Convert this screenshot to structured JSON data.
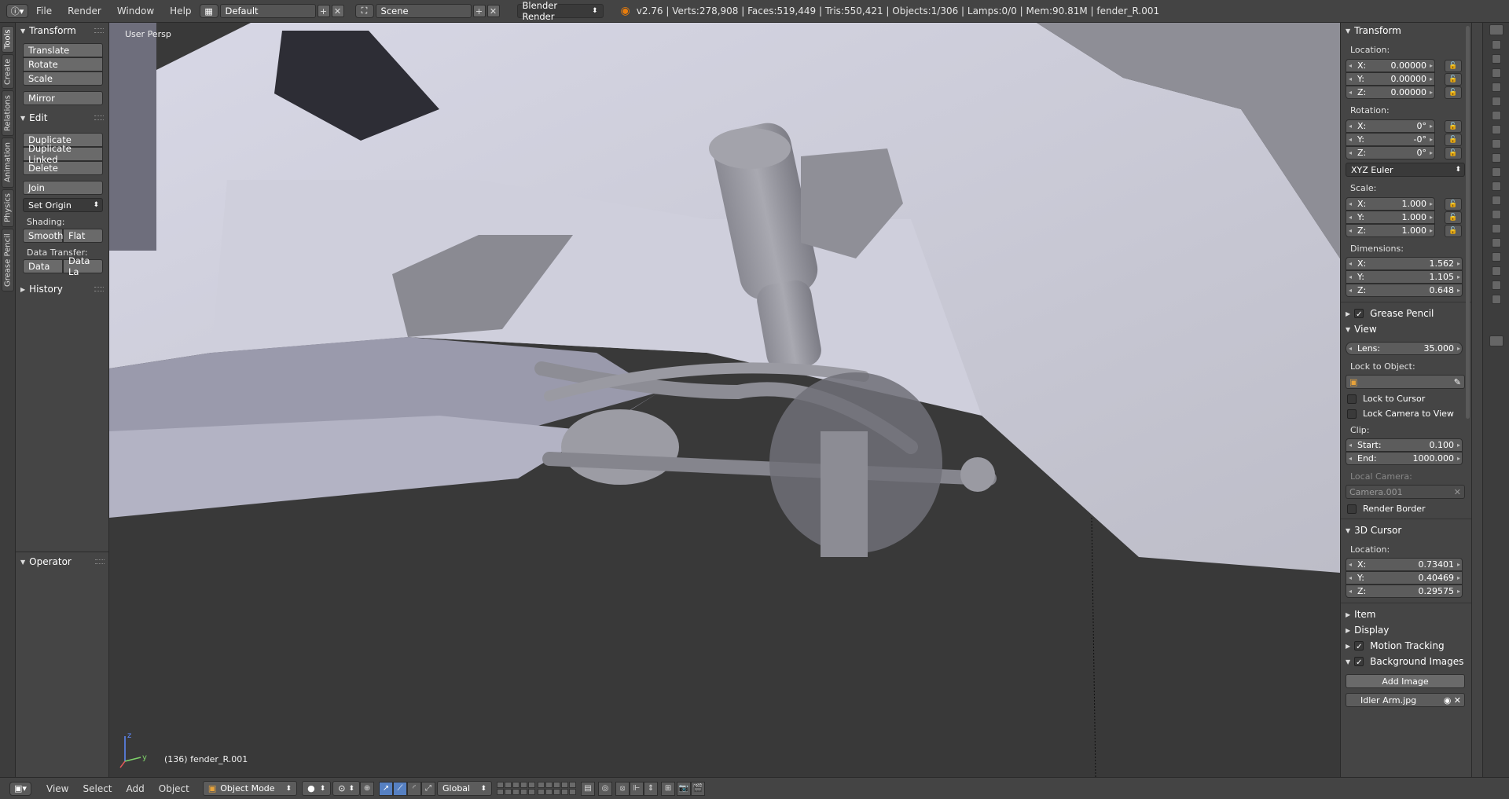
{
  "topbar": {
    "menus": [
      "File",
      "Render",
      "Window",
      "Help"
    ],
    "screen_layout": "Default",
    "scene": "Scene",
    "render_engine": "Blender Render",
    "stats": "v2.76 | Verts:278,908 | Faces:519,449 | Tris:550,421 | Objects:1/306 | Lamps:0/0 | Mem:90.81M | fender_R.001"
  },
  "tabs": [
    "Tools",
    "Create",
    "Relations",
    "Animation",
    "Physics",
    "Grease Pencil"
  ],
  "toolshelf": {
    "transform_title": "Transform",
    "translate": "Translate",
    "rotate": "Rotate",
    "scale": "Scale",
    "mirror": "Mirror",
    "edit_title": "Edit",
    "duplicate": "Duplicate",
    "duplicate_linked": "Duplicate Linked",
    "delete": "Delete",
    "join": "Join",
    "set_origin": "Set Origin",
    "shading_label": "Shading:",
    "smooth": "Smooth",
    "flat": "Flat",
    "data_transfer_label": "Data Transfer:",
    "data": "Data",
    "data_la": "Data La",
    "history_title": "History",
    "operator_title": "Operator"
  },
  "viewport": {
    "view_label": "User Persp",
    "object_label": "(136) fender_R.001",
    "axis_z": "z",
    "axis_y": "y"
  },
  "npanel": {
    "transform_title": "Transform",
    "location_label": "Location:",
    "location": {
      "x": "0.00000",
      "y": "0.00000",
      "z": "0.00000"
    },
    "rotation_label": "Rotation:",
    "rotation": {
      "x": "0°",
      "y": "-0°",
      "z": "0°"
    },
    "rotation_mode": "XYZ Euler",
    "scale_label": "Scale:",
    "scale": {
      "x": "1.000",
      "y": "1.000",
      "z": "1.000"
    },
    "dimensions_label": "Dimensions:",
    "dimensions": {
      "x": "1.562",
      "y": "1.105",
      "z": "0.648"
    },
    "grease_pencil_title": "Grease Pencil",
    "view_title": "View",
    "lens_label": "Lens:",
    "lens": "35.000",
    "lock_to_object_label": "Lock to Object:",
    "lock_to_cursor": "Lock to Cursor",
    "lock_camera_to_view": "Lock Camera to View",
    "clip_label": "Clip:",
    "clip_start_label": "Start:",
    "clip_start": "0.100",
    "clip_end_label": "End:",
    "clip_end": "1000.000",
    "local_camera_label": "Local Camera:",
    "local_camera": "Camera.001",
    "render_border": "Render Border",
    "cursor_title": "3D Cursor",
    "cursor_location_label": "Location:",
    "cursor": {
      "x": "0.73401",
      "y": "0.40469",
      "z": "0.29575"
    },
    "item_title": "Item",
    "display_title": "Display",
    "motion_tracking_title": "Motion Tracking",
    "background_images_title": "Background Images",
    "add_image": "Add Image",
    "bg_image_name": "Idler Arm.jpg"
  },
  "bottombar": {
    "menus": [
      "View",
      "Select",
      "Add",
      "Object"
    ],
    "mode": "Object Mode",
    "orientation": "Global"
  }
}
